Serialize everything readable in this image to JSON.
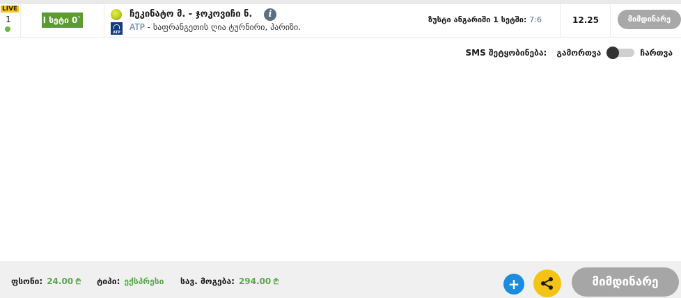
{
  "event": {
    "live_badge": "LIVE",
    "number": "1",
    "set_label": "I სეტი 0`",
    "match_title": "ჩეკინატო მ. - ჯოკოვიჩი ნ.",
    "info_icon": "info-icon",
    "sport_icon": "tennis-ball-icon",
    "org": "ATP",
    "tournament_name": "- საფრანგეთის ღია ტურნირი, პარიზი.",
    "market_label": "ზუსტი ანგარიში 1 სეტში:",
    "market_score": "7:6",
    "odds": "12.25",
    "status": "მიმდინარე"
  },
  "sms": {
    "label": "SMS შეტყობინება:",
    "off_label": "გამორთვა",
    "on_label": "ჩართვა"
  },
  "footer": {
    "stake_label": "ფსონი:",
    "stake_value": "24.00",
    "type_label": "ტიპი:",
    "type_value": "ექსპრესი",
    "win_label": "სავ. მოგება:",
    "win_value": "294.00",
    "currency": "₾",
    "plus_icon": "+",
    "share_icon": "share-icon",
    "status": "მიმდინარე"
  },
  "colors": {
    "live_yellow": "#f7c51e",
    "set_green": "#5a9b32",
    "value_green": "#59a84a",
    "status_gray": "#a8a8a8",
    "plus_blue": "#1e8bdc",
    "share_yellow": "#f5c316"
  }
}
